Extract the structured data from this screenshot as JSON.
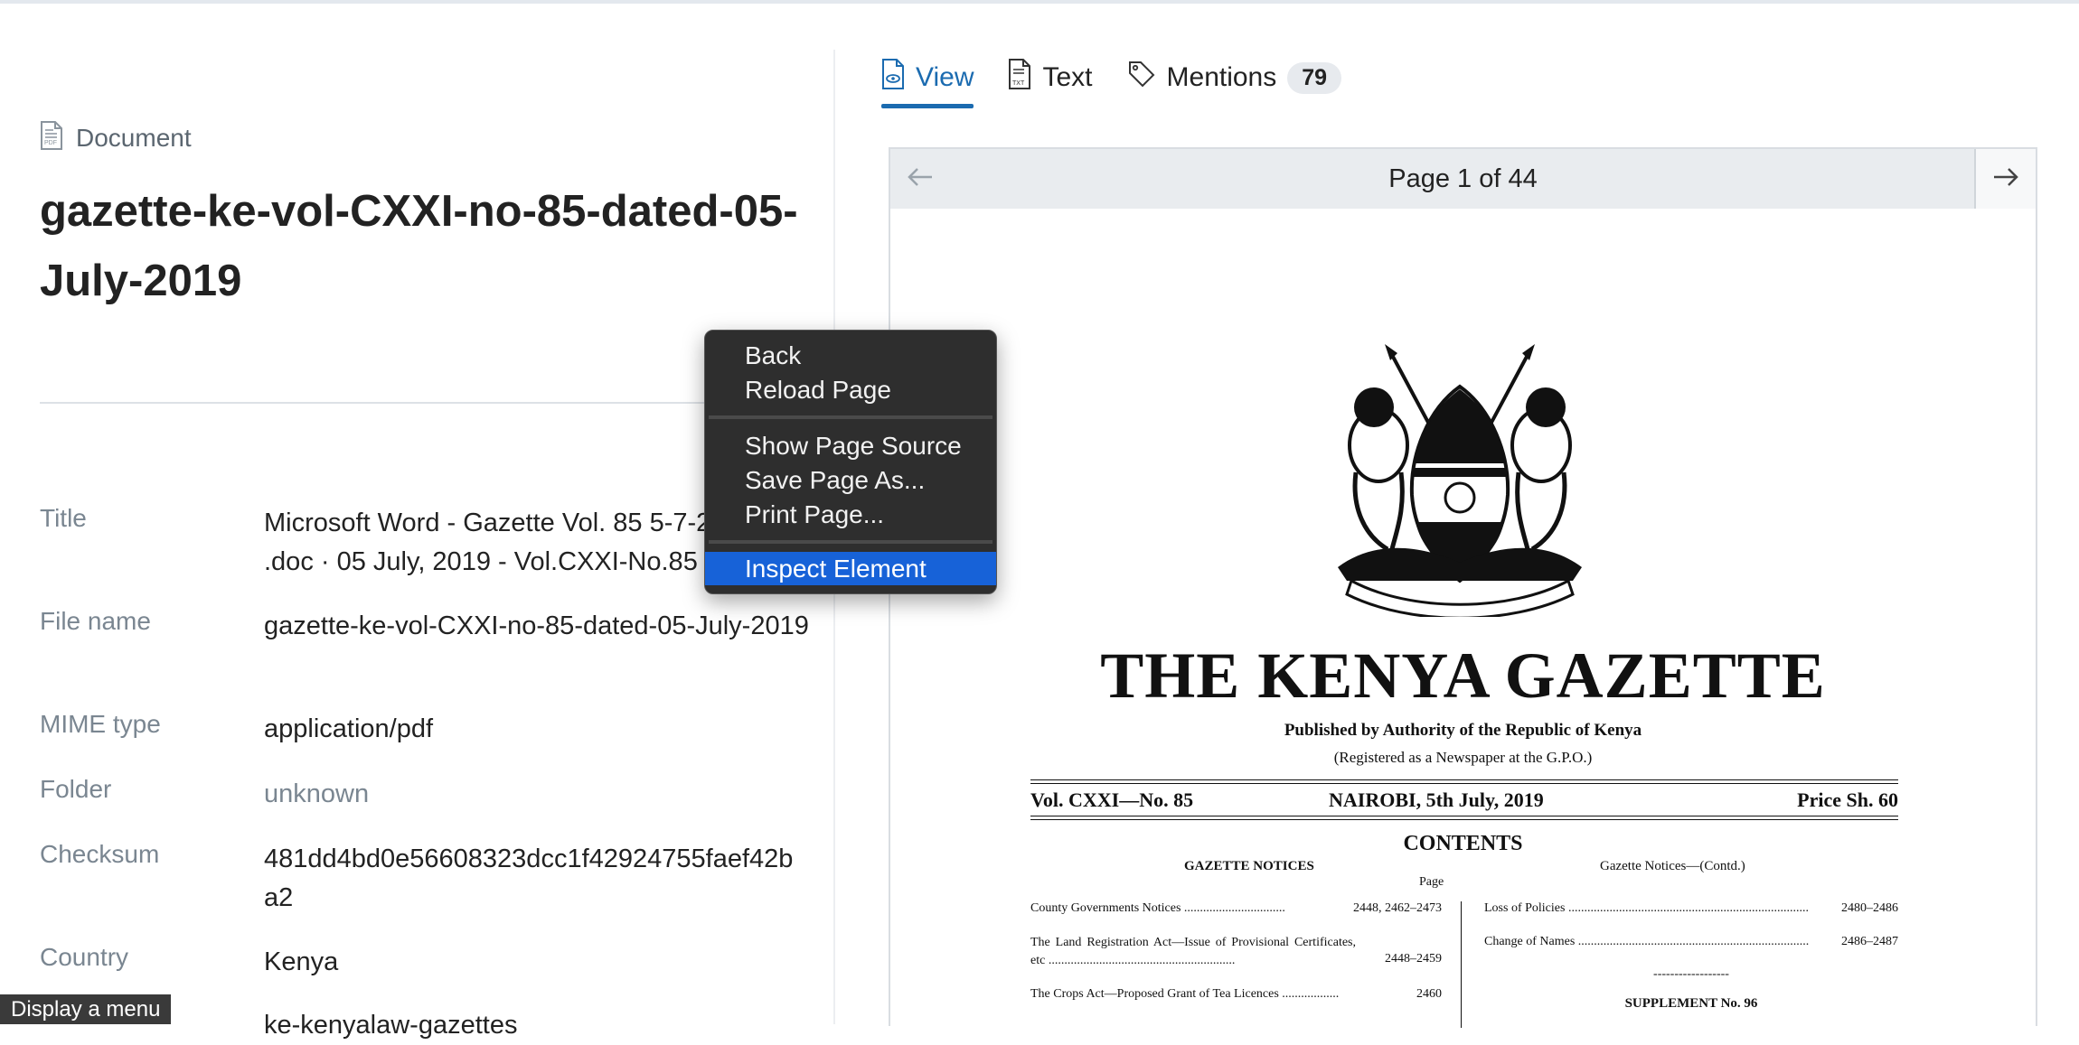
{
  "document": {
    "kicker": "Document",
    "title": "gazette-ke-vol-CXXI-no-85-dated-05-July-2019"
  },
  "metadata": [
    {
      "key": "Title",
      "value": "Microsoft Word - Gazette Vol. 85 5-7-2019 Main .doc · 05 July, 2019 - Vol.CXXI-No.85"
    },
    {
      "key": "File name",
      "value": "gazette-ke-vol-CXXI-no-85-dated-05-July-2019"
    },
    {
      "key": "MIME type",
      "value": "application/pdf"
    },
    {
      "key": "Folder",
      "value": "unknown"
    },
    {
      "key": "Checksum",
      "value": "481dd4bd0e56608323dcc1f42924755faef42ba2"
    },
    {
      "key": "Country",
      "value": "Kenya"
    },
    {
      "key": "",
      "value": "ke-kenyalaw-gazettes"
    }
  ],
  "status_tip": "Display a menu",
  "tabs": [
    {
      "label": "View",
      "icon": "file-view-icon",
      "active": true
    },
    {
      "label": "Text",
      "icon": "file-text-icon",
      "active": false
    },
    {
      "label": "Mentions",
      "icon": "tag-icon",
      "active": false,
      "count": "79"
    }
  ],
  "pager": {
    "label": "Page 1 of 44"
  },
  "gazette": {
    "masthead": "THE KENYA GAZETTE",
    "published_by": "Published by Authority of the Republic of Kenya",
    "registered": "(Registered as a Newspaper at the G.P.O.)",
    "vol": "Vol. CXXI—No. 85",
    "date": "NAIROBI, 5th July, 2019",
    "price": "Price Sh. 60",
    "contents": "CONTENTS",
    "col1_head": "GAZETTE NOTICES",
    "page_head": "Page",
    "col2_head": "Gazette Notices—(Contd.)",
    "motto": "HARAMBEE",
    "toc_left": [
      {
        "text": "County Governments Notices ................................",
        "page": "2448, 2462–2473"
      },
      {
        "text": "The Land Registration Act—Issue of Provisional Certificates, etc ...........................................................",
        "page": "2448–2459"
      },
      {
        "text": "The Crops Act—Proposed Grant of Tea Licences ..................",
        "page": "2460"
      }
    ],
    "toc_right": [
      {
        "text": "Loss of Policies .................................................................................",
        "page": "2480–2486"
      },
      {
        "text": "Change of Names ...........................................................................",
        "page": "2486–2487"
      }
    ],
    "dashes": "------------------",
    "supplement": "SUPPLEMENT No. 96"
  },
  "context_menu": {
    "items": [
      "Back",
      "Reload Page",
      "Show Page Source",
      "Save Page As...",
      "Print Page...",
      "Inspect Element"
    ],
    "highlighted": "Inspect Element"
  }
}
